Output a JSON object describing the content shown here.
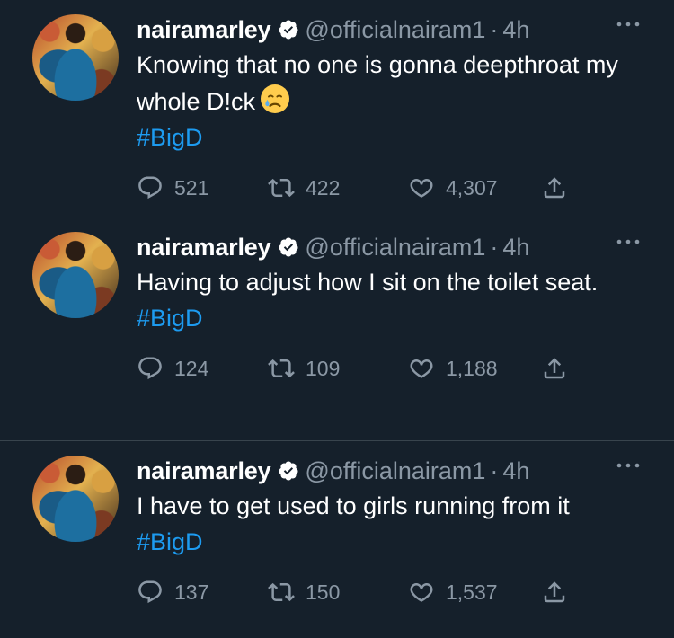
{
  "colors": {
    "background": "#15202b",
    "divider": "#38444d",
    "text": "#ffffff",
    "muted": "#8b98a5",
    "link": "#1d9bf0",
    "verified": "#ffffff"
  },
  "tweets": [
    {
      "name": "nairamarley",
      "handle": "@officialnairam1",
      "separator": "·",
      "time": "4h",
      "text": "Knowing that no one is gonna deepthroat my whole D!ck",
      "emoji": "crying-face-emoji",
      "hashtag": "#BigD",
      "replies": "521",
      "retweets": "422",
      "likes": "4,307"
    },
    {
      "name": "nairamarley",
      "handle": "@officialnairam1",
      "separator": "·",
      "time": "4h",
      "text": "Having to adjust how I sit on the toilet seat.",
      "hashtag": "#BigD",
      "replies": "124",
      "retweets": "109",
      "likes": "1,188"
    },
    {
      "name": "nairamarley",
      "handle": "@officialnairam1",
      "separator": "·",
      "time": "4h",
      "text": "I have to get used to girls running from it",
      "hashtag": "#BigD",
      "replies": "137",
      "retweets": "150",
      "likes": "1,537"
    }
  ],
  "icons": {
    "verified": "verified-badge-icon",
    "more": "more-options-icon",
    "reply": "reply-icon",
    "retweet": "retweet-icon",
    "like": "like-heart-icon",
    "share": "share-icon"
  }
}
